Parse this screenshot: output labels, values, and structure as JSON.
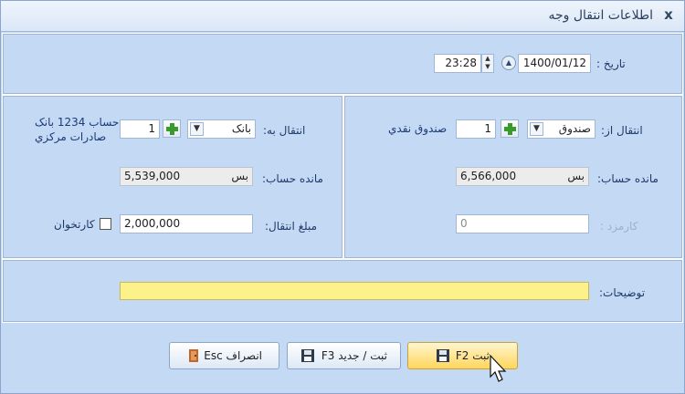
{
  "dialog": {
    "title": "اطلاعات انتقال وجه",
    "close_glyph": "x"
  },
  "top": {
    "date_label": "تاریخ :",
    "date_value": "1400/01/12",
    "time_value": "23:28"
  },
  "from": {
    "label": "انتقال از:",
    "type": "صندوق",
    "number": "1",
    "name": "صندوق نقدي",
    "balance_label": "مانده حساب:",
    "balance_value": "6,566,000",
    "balance_unit": "بس",
    "fee_label": "كارمزد :",
    "fee_value": "0"
  },
  "to": {
    "label": "انتقال به:",
    "type": "بانک",
    "number": "1",
    "name_line1": "حساب 1234 بانک",
    "name_line2": "صادرات مرکزي",
    "balance_label": "مانده حساب:",
    "balance_value": "5,539,000",
    "balance_unit": "بس",
    "amount_label": "مبلغ انتقال:",
    "amount_value": "2,000,000",
    "cardreader_label": "كارتخوان"
  },
  "notes": {
    "label": "توضيحات:",
    "value": ""
  },
  "buttons": {
    "save": "ثبت F2",
    "save_new": "ثبت / جديد F3",
    "cancel": "انصراف Esc"
  },
  "colors": {
    "background": "#c4d9f3",
    "notes_field": "#fdf28a",
    "active_button": "#ffd55c",
    "plus_icon": "#3b9a2c"
  }
}
